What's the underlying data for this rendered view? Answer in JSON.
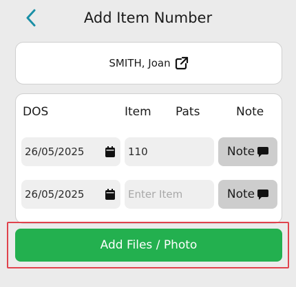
{
  "header": {
    "title": "Add Item Number",
    "back_icon": "chevron-left-icon"
  },
  "patient": {
    "name": "SMITH, Joan",
    "link_icon": "external-link-icon"
  },
  "table": {
    "columns": [
      "DOS",
      "Item",
      "Pats",
      "Note"
    ],
    "rows": [
      {
        "dos": "26/05/2025",
        "item_value": "110",
        "item_placeholder": "Enter Item",
        "note_label": "Note"
      },
      {
        "dos": "26/05/2025",
        "item_value": "",
        "item_placeholder": "Enter Item",
        "note_label": "Note"
      }
    ]
  },
  "actions": {
    "add_files_label": "Add Files / Photo"
  },
  "colors": {
    "accent": "#1a8fa6",
    "primary_button": "#23b04f",
    "highlight": "#e0424c",
    "background": "#ebebeb"
  }
}
